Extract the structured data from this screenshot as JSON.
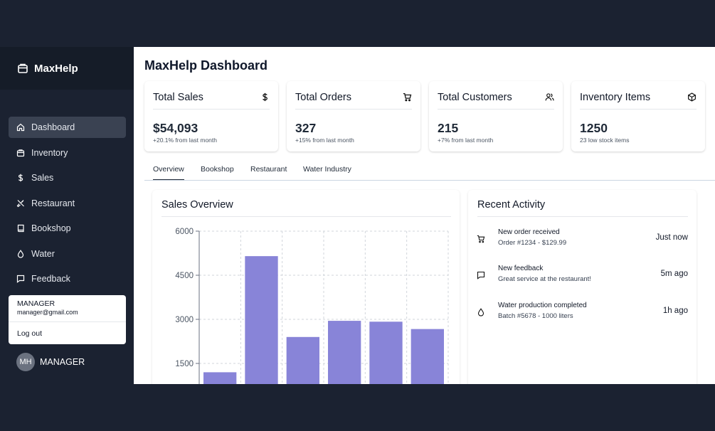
{
  "sidebar": {
    "brand": "MaxHelp",
    "items": [
      {
        "label": "Dashboard",
        "icon": "home-icon"
      },
      {
        "label": "Inventory",
        "icon": "box-icon"
      },
      {
        "label": "Sales",
        "icon": "dollar-icon"
      },
      {
        "label": "Restaurant",
        "icon": "utensils-icon"
      },
      {
        "label": "Bookshop",
        "icon": "book-icon"
      },
      {
        "label": "Water",
        "icon": "droplet-icon"
      },
      {
        "label": "Feedback",
        "icon": "message-icon"
      }
    ],
    "user_menu": {
      "role": "MANAGER",
      "email": "manager@gmail.com",
      "logout": "Log out"
    },
    "user": {
      "initials": "MH",
      "name": "MANAGER"
    }
  },
  "header": {
    "title": "MaxHelp Dashboard"
  },
  "cards": [
    {
      "title": "Total Sales",
      "value": "$54,093",
      "sub": "+20.1% from last month",
      "icon": "dollar-icon"
    },
    {
      "title": "Total Orders",
      "value": "327",
      "sub": "+15% from last month",
      "icon": "cart-icon"
    },
    {
      "title": "Total Customers",
      "value": "215",
      "sub": "+7% from last month",
      "icon": "users-icon"
    },
    {
      "title": "Inventory Items",
      "value": "1250",
      "sub": "23 low stock items",
      "icon": "package-icon"
    }
  ],
  "tabs": [
    "Overview",
    "Bookshop",
    "Restaurant",
    "Water Industry"
  ],
  "sales_overview": {
    "title": "Sales Overview"
  },
  "recent_activity": {
    "title": "Recent Activity",
    "items": [
      {
        "title": "New order received",
        "sub": "Order #1234 - $129.99",
        "time": "Just now",
        "icon": "cart-icon"
      },
      {
        "title": "New feedback",
        "sub": "Great service at the restaurant!",
        "time": "5m ago",
        "icon": "message-icon"
      },
      {
        "title": "Water production completed",
        "sub": "Batch #5678 - 1000 liters",
        "time": "1h ago",
        "icon": "droplet-icon"
      }
    ]
  },
  "colors": {
    "bar": "#8884d8",
    "sidebar_bg": "#1b2231",
    "active_nav": "#3a4252"
  },
  "chart_data": {
    "type": "bar",
    "title": "Sales Overview",
    "categories": [
      "",
      "",
      "",
      "",
      "",
      ""
    ],
    "values": [
      1200,
      5150,
      2400,
      2950,
      2920,
      2670
    ],
    "yticks": [
      1500,
      3000,
      4500,
      6000
    ],
    "ylim": [
      0,
      6000
    ],
    "grid": true
  }
}
